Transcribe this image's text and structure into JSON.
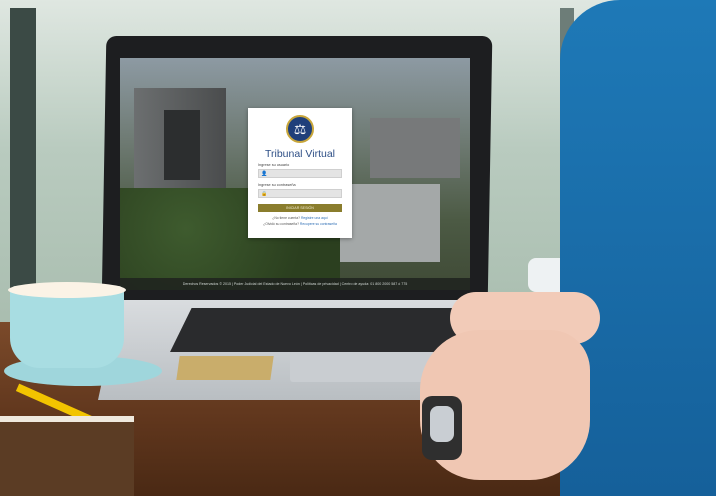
{
  "login": {
    "title": "Tribunal Virtual",
    "user_label": "Ingrese su usuario",
    "password_label": "Ingrese su contraseña",
    "submit_label": "INICIAR SESIÓN",
    "register_prompt": "¿No tiene cuenta?",
    "register_link": "Registre una aquí",
    "forgot_prompt": "¿Olvidó su contraseña?",
    "forgot_link": "Recupere su contraseña"
  },
  "footer": {
    "text": "Derechos Reservados © 2015 | Poder Judicial del Estado de Nuevo León | Políticas de privacidad | Centro de ayuda: 01 800 2000 587 ó 775"
  },
  "icons": {
    "user": "user-icon",
    "lock": "lock-icon",
    "seal": "seal-icon"
  },
  "colors": {
    "title": "#2e4f86",
    "button": "#8a7d2d",
    "link": "#2f6fb5"
  }
}
